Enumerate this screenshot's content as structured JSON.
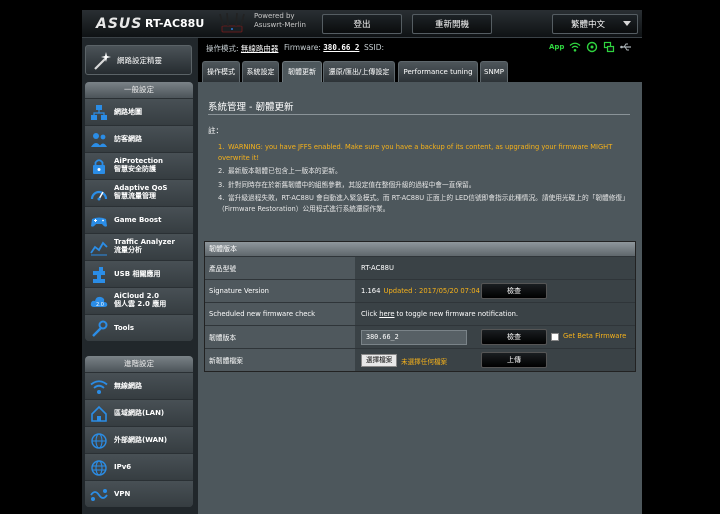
{
  "header": {
    "logo": "ASUS",
    "model": "RT-AC88U",
    "powered_by": "Powered by",
    "powered_name": "Asuswrt-Merlin",
    "logout_label": "登出",
    "reboot_label": "重新開機",
    "language": "繁體中文"
  },
  "statusbar": {
    "op_mode_label": "操作模式:",
    "op_mode_value": "無線路由器",
    "firmware_label": "Firmware:",
    "firmware_value": "380.66_2",
    "ssid_label": "SSID:",
    "app_label": "App"
  },
  "sidebar": {
    "wizard_label": "網路設定精靈",
    "general_title": "一般設定",
    "general_items": [
      {
        "label": "網路地圖",
        "icon": "network-map-icon"
      },
      {
        "label": "訪客網路",
        "icon": "guest-network-icon"
      },
      {
        "label": "AiProtection",
        "label2": "智慧安全防護",
        "icon": "aiprotection-icon"
      },
      {
        "label": "Adaptive QoS",
        "label2": "智慧流量管理",
        "icon": "qos-icon"
      },
      {
        "label": "Game Boost",
        "icon": "game-boost-icon"
      },
      {
        "label": "Traffic Analyzer",
        "label2": "流量分析",
        "icon": "traffic-analyzer-icon"
      },
      {
        "label": "USB 相關應用",
        "icon": "usb-icon"
      },
      {
        "label": "AiCloud 2.0",
        "label2": "個人雲 2.0 應用",
        "icon": "aicloud-icon"
      },
      {
        "label": "Tools",
        "icon": "tools-icon"
      }
    ],
    "advanced_title": "進階設定",
    "advanced_items": [
      {
        "label": "無線網路",
        "icon": "wireless-icon"
      },
      {
        "label": "區域網路(LAN)",
        "icon": "lan-icon"
      },
      {
        "label": "外部網路(WAN)",
        "icon": "wan-icon"
      },
      {
        "label": "IPv6",
        "icon": "ipv6-icon"
      },
      {
        "label": "VPN",
        "icon": "vpn-icon"
      }
    ]
  },
  "tabs": [
    {
      "label": "操作模式",
      "active": false
    },
    {
      "label": "系統設定",
      "active": false
    },
    {
      "label": "韌體更新",
      "active": true
    },
    {
      "label": "還原/匯出/上傳設定",
      "active": false
    },
    {
      "label": "Performance tuning",
      "active": false
    },
    {
      "label": "SNMP",
      "active": false
    }
  ],
  "content": {
    "title": "系統管理 - 韌體更新",
    "note_label": "註：",
    "notes": [
      {
        "num": "1.",
        "text": "WARNING: you have JFFS enabled. Make sure you have a backup of its content, as upgrading your firmware MIGHT overwrite it!",
        "warn": true
      },
      {
        "num": "2.",
        "text": "最新版本韌體已包含上一版本的更新。",
        "warn": false
      },
      {
        "num": "3.",
        "text": "針對同時存在於新舊韌體中的組態參數，其設定值在整個升級的過程中會一直保留。",
        "warn": false
      },
      {
        "num": "4.",
        "text": "當升級過程失敗，RT-AC88U 會自動進入緊急模式。而 RT-AC88U 正面上的 LED信號即會指示此種情況。請使用光碟上的「韌體修復」（Firmware Restoration）公用程式進行系統還原作業。",
        "warn": false
      }
    ],
    "table": {
      "header": "韌體版本",
      "product_label": "產品型號",
      "product_value": "RT-AC88U",
      "sig_label": "Signature Version",
      "sig_value": "1.164",
      "sig_updated": "Updated : 2017/05/20 07:04",
      "check_label": "檢查",
      "sched_label": "Scheduled new firmware check",
      "sched_pre": "Click",
      "sched_link": "here",
      "sched_post": "to toggle new firmware notification.",
      "fw_label": "韌體版本",
      "fw_value": "380.66_2",
      "beta_label": "Get Beta Firmware",
      "newfw_label": "新韌體檔案",
      "choose_label": "選擇檔案",
      "no_file": "未選擇任何檔案",
      "upload_label": "上傳"
    }
  },
  "colors": {
    "warning": "#f6b21b",
    "app_green": "#2fd43f",
    "panel_bg": "#4d575c"
  }
}
